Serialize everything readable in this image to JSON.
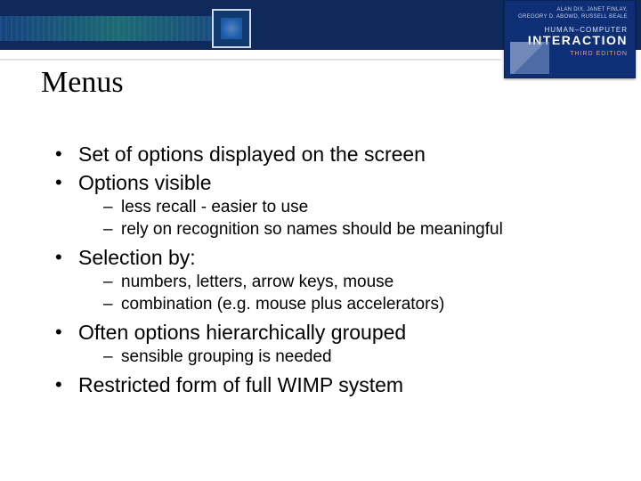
{
  "book": {
    "authors_line1": "ALAN DIX, JANET FINLAY,",
    "authors_line2": "GREGORY D. ABOWD, RUSSELL BEALE",
    "title_small": "HUMAN–COMPUTER",
    "title_large": "INTERACTION",
    "edition": "THIRD EDITION"
  },
  "slide": {
    "title": "Menus",
    "bullets": [
      {
        "text": "Set of options displayed on the screen",
        "sub": []
      },
      {
        "text": "Options visible",
        "sub": [
          "less recall - easier to use",
          "rely on recognition so names should be meaningful"
        ]
      },
      {
        "text": "Selection by:",
        "sub": [
          "numbers, letters, arrow keys, mouse",
          "combination  (e.g. mouse plus accelerators)"
        ]
      },
      {
        "text": "Often options hierarchically grouped",
        "sub": [
          "sensible grouping is needed"
        ]
      },
      {
        "text": "Restricted form of full WIMP system",
        "sub": []
      }
    ]
  }
}
